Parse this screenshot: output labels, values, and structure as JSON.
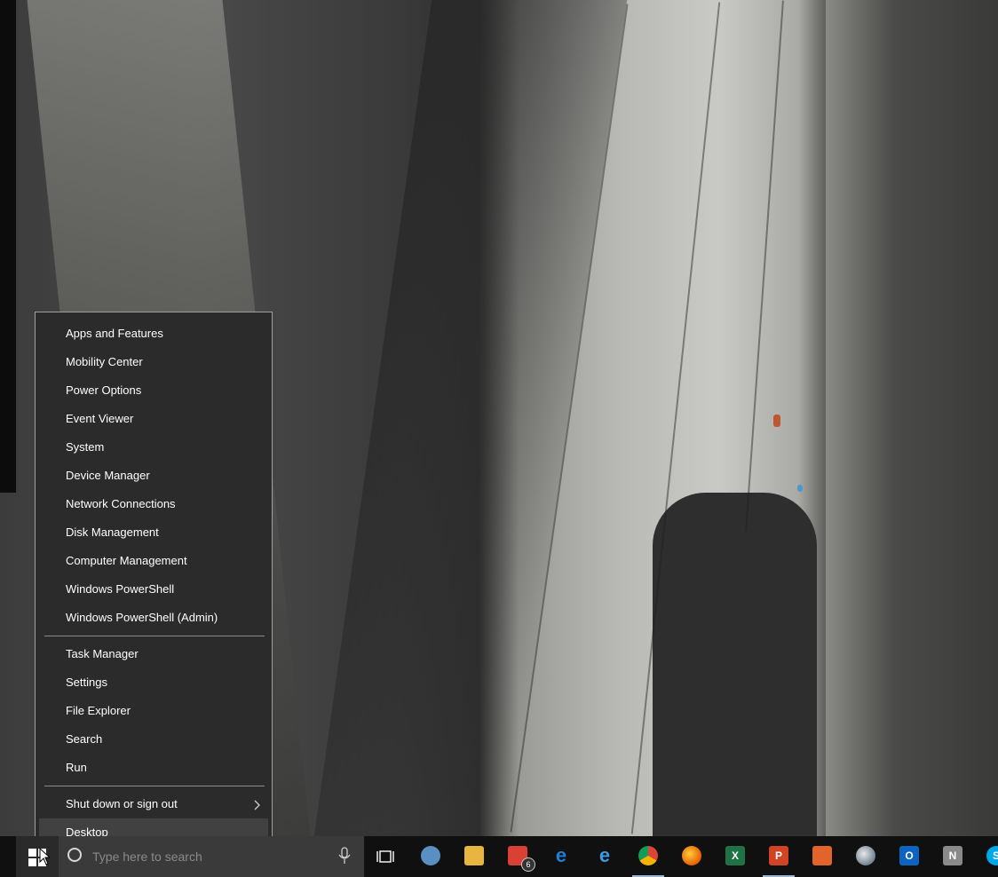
{
  "menu": {
    "items": [
      {
        "label": "Apps and Features"
      },
      {
        "label": "Mobility Center"
      },
      {
        "label": "Power Options"
      },
      {
        "label": "Event Viewer"
      },
      {
        "label": "System"
      },
      {
        "label": "Device Manager"
      },
      {
        "label": "Network Connections"
      },
      {
        "label": "Disk Management"
      },
      {
        "label": "Computer Management"
      },
      {
        "label": "Windows PowerShell"
      },
      {
        "label": "Windows PowerShell (Admin)"
      },
      {
        "label": "Task Manager"
      },
      {
        "label": "Settings"
      },
      {
        "label": "File Explorer"
      },
      {
        "label": "Search"
      },
      {
        "label": "Run"
      },
      {
        "label": "Shut down or sign out"
      },
      {
        "label": "Desktop"
      }
    ],
    "highlighted": "Desktop"
  },
  "taskbar": {
    "search_placeholder": "Type here to search",
    "apps": [
      {
        "name": "task-view-icon"
      },
      {
        "name": "snipping-tool-icon"
      },
      {
        "name": "file-explorer-icon"
      },
      {
        "name": "todoist-icon",
        "badge": "6"
      },
      {
        "name": "edge-icon"
      },
      {
        "name": "internet-explorer-icon"
      },
      {
        "name": "chrome-icon",
        "active": true
      },
      {
        "name": "firefox-icon"
      },
      {
        "name": "excel-icon"
      },
      {
        "name": "powerpoint-icon",
        "active": true
      },
      {
        "name": "presentation-app-icon"
      },
      {
        "name": "globe-app-icon"
      },
      {
        "name": "outlook-icon"
      },
      {
        "name": "onenote-icon"
      },
      {
        "name": "skype-icon"
      }
    ]
  },
  "colors": {
    "menu_bg": "#2b2b2b",
    "menu_highlight": "#414141",
    "taskbar_bg": "#101010",
    "search_bg": "#3a3a3a"
  }
}
